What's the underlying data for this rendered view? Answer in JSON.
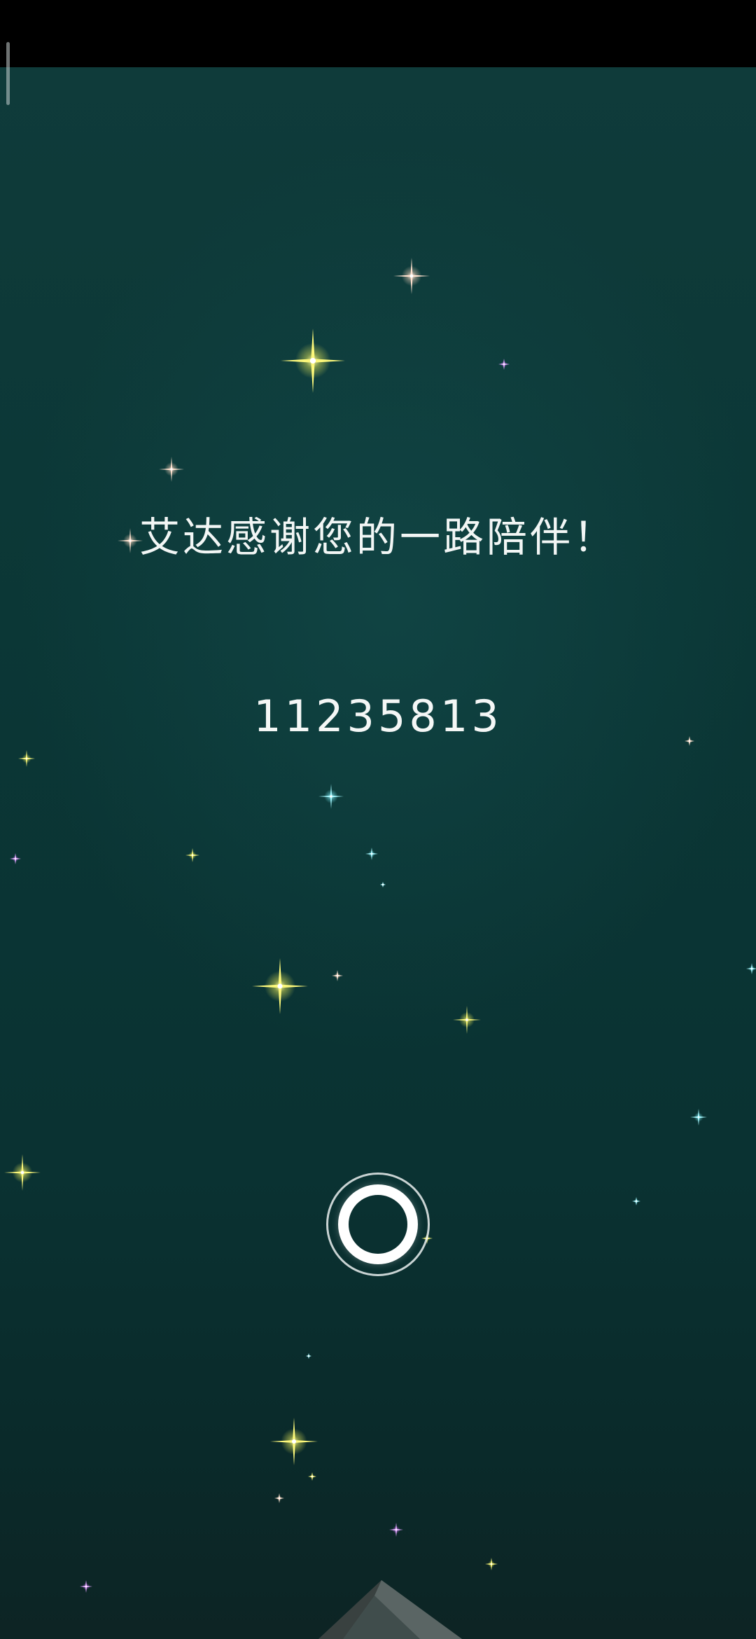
{
  "message": {
    "thanks": "艾达感谢您的一路陪伴！",
    "code": "11235813"
  },
  "icons": {
    "ring_button": "circle-ring-icon",
    "stars": "sparkle-star-icon",
    "roof": "roof-silhouette-icon"
  },
  "colors": {
    "background_top": "#0f3b3a",
    "background_bottom": "#0d2424",
    "star_gold": "#f4f35a",
    "star_peach": "#ffd8c0",
    "star_cyan": "#7ff4ff",
    "star_violet": "#d87cff",
    "text": "#f2f6f5"
  }
}
